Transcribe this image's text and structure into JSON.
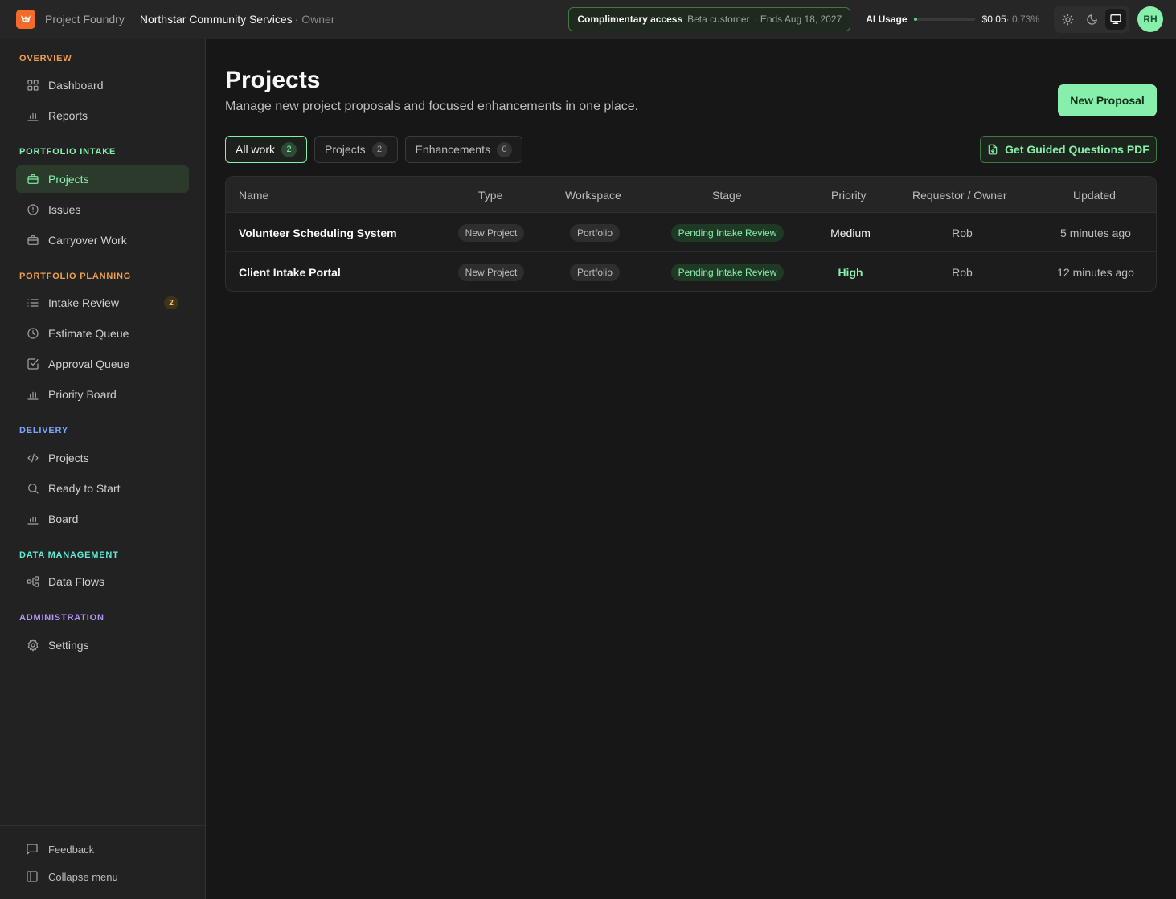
{
  "topbar": {
    "app_name": "Project Foundry",
    "org_name": "Northstar Community Services",
    "org_role": "· Owner",
    "access_label": "Complimentary access",
    "access_plan": "Beta customer",
    "access_ends": "· Ends Aug 18, 2027",
    "ai_usage_label": "AI Usage",
    "ai_usage_amount": "$0.05",
    "ai_usage_percent": "· 0.73%",
    "ai_usage_fraction": 0.0073,
    "avatar_initials": "RH",
    "theme_options": [
      "light",
      "dark",
      "system"
    ],
    "theme_active": "system"
  },
  "sidebar": {
    "sections": [
      {
        "title": "OVERVIEW",
        "color": "#f0a04b"
      },
      {
        "title": "PORTFOLIO INTAKE",
        "color": "#86efac"
      },
      {
        "title": "PORTFOLIO PLANNING",
        "color": "#f0a04b"
      },
      {
        "title": "DELIVERY",
        "color": "#7aa6ff"
      },
      {
        "title": "DATA MANAGEMENT",
        "color": "#5eead4"
      },
      {
        "title": "ADMINISTRATION",
        "color": "#b794f6"
      }
    ],
    "items": [
      {
        "label": "Dashboard",
        "icon": "grid-icon"
      },
      {
        "label": "Reports",
        "icon": "bar-chart-icon"
      },
      {
        "label": "Projects",
        "icon": "briefcase-icon",
        "active": true
      },
      {
        "label": "Issues",
        "icon": "alert-circle-icon"
      },
      {
        "label": "Carryover Work",
        "icon": "briefcase-icon"
      },
      {
        "label": "Intake Review",
        "icon": "list-icon",
        "badge": "2"
      },
      {
        "label": "Estimate Queue",
        "icon": "clock-icon"
      },
      {
        "label": "Approval Queue",
        "icon": "check-square-icon"
      },
      {
        "label": "Priority Board",
        "icon": "bar-chart-icon"
      },
      {
        "label": "Projects",
        "icon": "code-icon"
      },
      {
        "label": "Ready to Start",
        "icon": "search-icon"
      },
      {
        "label": "Board",
        "icon": "bar-chart-icon"
      },
      {
        "label": "Data Flows",
        "icon": "workflow-icon"
      },
      {
        "label": "Settings",
        "icon": "gear-icon"
      }
    ],
    "footer": {
      "feedback": "Feedback",
      "collapse": "Collapse menu"
    }
  },
  "main": {
    "title": "Projects",
    "subtitle": "Manage new project proposals and focused enhancements in one place.",
    "new_button": "New Proposal",
    "pdf_button": "Get Guided Questions PDF",
    "tabs": [
      {
        "label": "All work",
        "count": "2",
        "active": true
      },
      {
        "label": "Projects",
        "count": "2"
      },
      {
        "label": "Enhancements",
        "count": "0"
      }
    ],
    "table": {
      "columns": [
        "Name",
        "Type",
        "Workspace",
        "Stage",
        "Priority",
        "Requestor / Owner",
        "Updated"
      ],
      "rows": [
        {
          "name": "Volunteer Scheduling System",
          "type": "New Project",
          "workspace": "Portfolio",
          "stage": "Pending Intake Review",
          "priority": "Medium",
          "owner": "Rob",
          "updated": "5 minutes ago"
        },
        {
          "name": "Client Intake Portal",
          "type": "New Project",
          "workspace": "Portfolio",
          "stage": "Pending Intake Review",
          "priority": "High",
          "owner": "Rob",
          "updated": "12 minutes ago"
        }
      ]
    }
  },
  "colors": {
    "accent": "#86efac",
    "brand": "#f26b2a",
    "badge_text": "#f3c35a"
  }
}
